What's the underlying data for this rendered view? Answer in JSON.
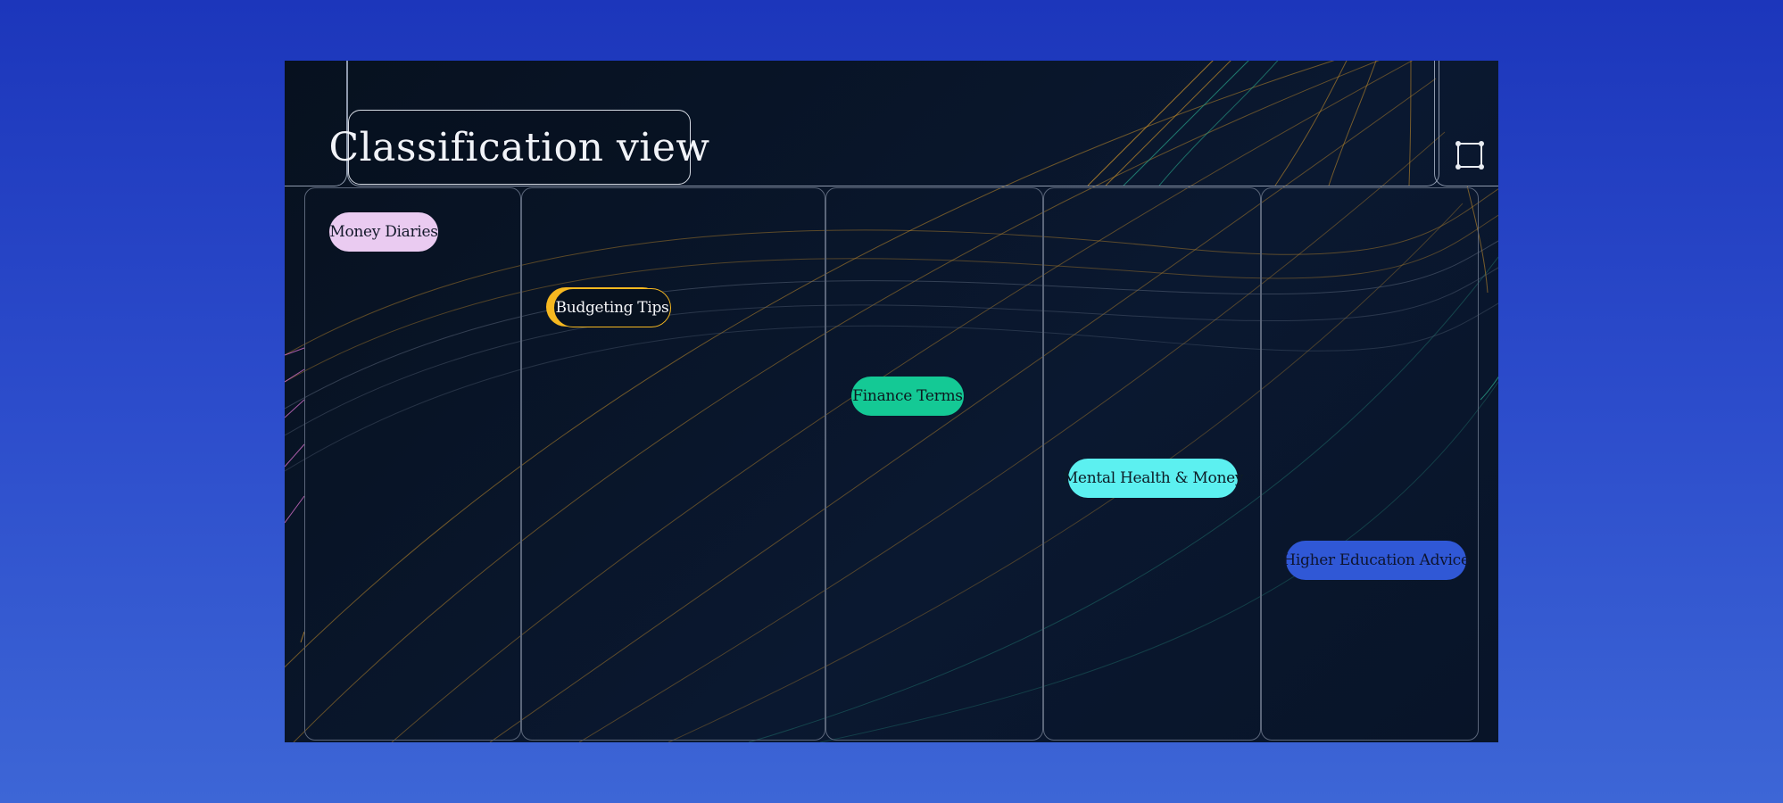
{
  "page": {
    "title": "Classification view"
  },
  "toolbar": {
    "frame_icon": "frame-selection-icon"
  },
  "columns": [
    {
      "tag": "Money Diaries",
      "color": "#eacbf1"
    },
    {
      "tag": "Budgeting Tips",
      "color": "#f6b820"
    },
    {
      "tag": "Finance Terms",
      "color": "#14c995"
    },
    {
      "tag": "Mental Health & Money",
      "color": "#5cf0f0"
    },
    {
      "tag": "Higher Education Advice",
      "color": "#3058d6"
    }
  ],
  "colors": {
    "background_top": "#1c36bb",
    "background_bottom": "#3d66d6",
    "panel": "#07111f",
    "accent_gold": "#f6b820",
    "accent_teal": "#14c995",
    "line": "#8e99ad"
  }
}
